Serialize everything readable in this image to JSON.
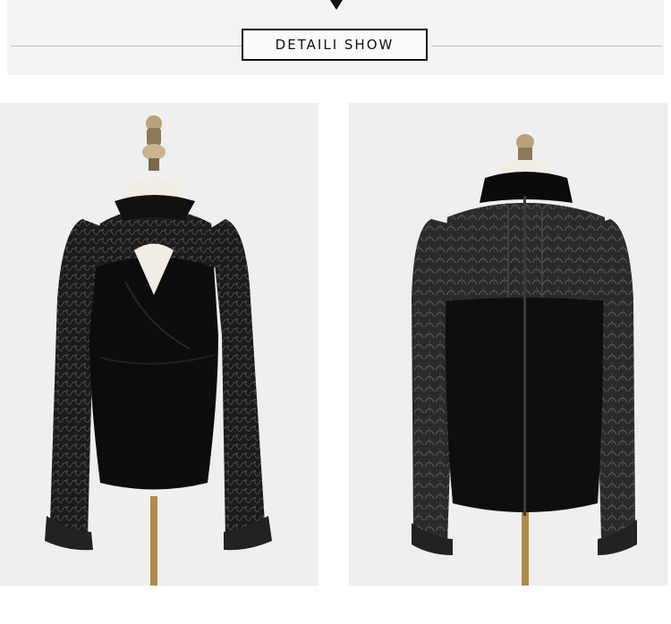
{
  "header": {
    "title": "DETAILI SHOW",
    "arrow_icon": "triangle-down-icon"
  },
  "photos": [
    {
      "view": "front"
    },
    {
      "view": "back"
    }
  ],
  "colors": {
    "background": "#ffffff",
    "band": "#f4f4f4",
    "photo_bg": "#efefef",
    "garment": "#0c0c0c",
    "lace": "#2a2a2a"
  }
}
